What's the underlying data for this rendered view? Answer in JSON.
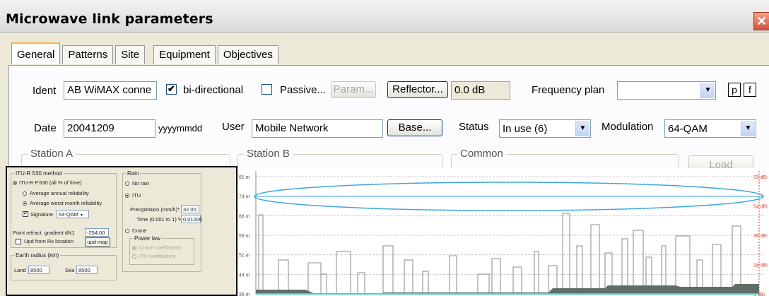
{
  "window": {
    "title": "Microwave link parameters",
    "close_glyph": "✕"
  },
  "tabs": [
    {
      "label": "General",
      "active": true
    },
    {
      "label": "Patterns",
      "active": false
    },
    {
      "label": "Site",
      "active": false
    },
    {
      "label": "Equipment",
      "active": false
    },
    {
      "label": "Objectives",
      "active": false
    }
  ],
  "general": {
    "ident_label": "Ident",
    "ident_value": "AB WiMAX conne",
    "bidirectional_label": "bi-directional",
    "bidirectional_checked": "✔",
    "passive_label": "Passive...",
    "param_button": "Param...",
    "reflector_button": "Reflector...",
    "reflector_value": "0.0 dB",
    "frequency_plan_label": "Frequency plan",
    "frequency_plan_value": "",
    "p_button": "p",
    "f_button": "f",
    "date_label": "Date",
    "date_value": "20041209",
    "date_format": "yyyymmdd",
    "user_label": "User",
    "user_value": "Mobile Network",
    "base_button": "Base...",
    "status_label": "Status",
    "status_value": "In use (6)",
    "modulation_label": "Modulation",
    "modulation_value": "64-QAM",
    "station_a_label": "Station A",
    "station_b_label": "Station B",
    "common_label": "Common",
    "load_button": "Load",
    "dropdown_arrow": "▼"
  },
  "inset": {
    "itu_method_title": "ITU-R 530 method",
    "itu_p530": "ITU-R P.530 (all % of time)",
    "avg_annual": "Average annual reliability",
    "avg_worst_month": "Average worst month reliability",
    "signature_label": "Signature",
    "signature_value": "64-QAM",
    "point_refract_label": "Point refract. gradient dN1",
    "point_refract_value": "-254.00",
    "upd_rx_label": "Upd from Rx location",
    "upd_map_button": "upd map",
    "earth_radius_title": "Earth radius (km)",
    "land_label": "Land",
    "land_value": "8500",
    "sea_label": "Sea",
    "sea_value": "8500",
    "rain_title": "Rain",
    "no_rain": "No rain",
    "itu": "ITU",
    "precip_label": "Precipitation (mm/h)*",
    "precip_value": "32.00",
    "time_label": "Time (0.001 to 1) %",
    "time_value": "0.01000",
    "crane": "Crane",
    "power_law_title": "Power law",
    "crane_coeff": "Crane coefficients",
    "itu_coeff": "ITU coefficients"
  },
  "chart_data": {
    "type": "area",
    "y_ticks_left": [
      "81 m",
      "74 m",
      "66 m",
      "59 m",
      "51 m",
      "44 m",
      "36 m"
    ],
    "y_ticks_right": [
      "72 dBi",
      "54 dBi",
      "36 dBi",
      "18 dBi",
      "0 dBi"
    ],
    "ylim": [
      36,
      81
    ],
    "colors": {
      "fresnel": "#3ea7e0",
      "terrain": "#5f6f66",
      "grid": "#c8c8c8",
      "right_axis": "#e23b2c"
    }
  }
}
